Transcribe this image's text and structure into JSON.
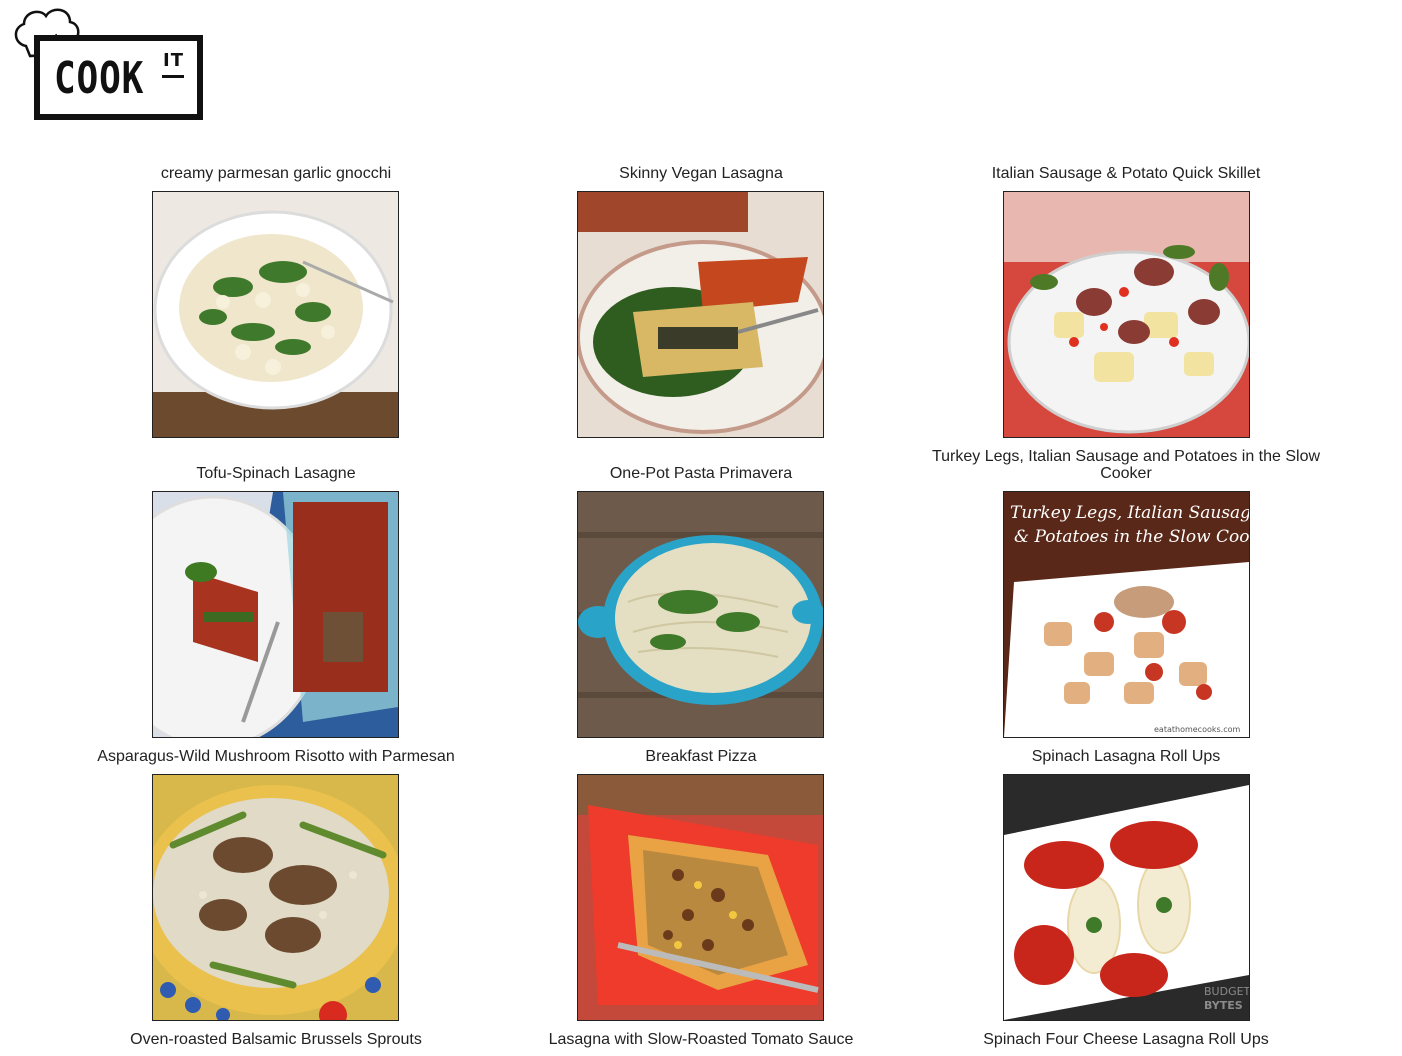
{
  "brand": {
    "logo_text": "COOK",
    "logo_superscript": "IT"
  },
  "recipes": [
    {
      "title": "creamy parmesan garlic gnocchi",
      "icon": "gnocchi-photo"
    },
    {
      "title": "Skinny Vegan Lasagna",
      "icon": "lasagna-photo"
    },
    {
      "title": "Italian Sausage & Potato Quick Skillet",
      "icon": "sausage-skillet-photo"
    },
    {
      "title": "Tofu-Spinach Lasagne",
      "icon": "lasagne-photo"
    },
    {
      "title": "One-Pot Pasta Primavera",
      "icon": "pasta-pot-photo"
    },
    {
      "title": "Turkey Legs, Italian Sausage and Potatoes in the Slow Cooker",
      "icon": "turkey-potatoes-photo",
      "image_overlay_text": "Turkey Legs, Italian Sausage & Potatoes in the Slow Cooker",
      "image_watermark": "eatathomecooks.com"
    },
    {
      "title": "Asparagus-Wild Mushroom Risotto with Parmesan",
      "icon": "risotto-photo"
    },
    {
      "title": "Breakfast Pizza",
      "icon": "pizza-photo"
    },
    {
      "title": "Spinach Lasagna Roll Ups",
      "icon": "lasagna-rolls-photo",
      "image_watermark": "BUDGET BYTES"
    },
    {
      "title": "Oven-roasted Balsamic Brussels Sprouts"
    },
    {
      "title": "Lasagna with Slow-Roasted Tomato Sauce"
    },
    {
      "title": "Spinach Four Cheese Lasagna Roll Ups"
    }
  ]
}
